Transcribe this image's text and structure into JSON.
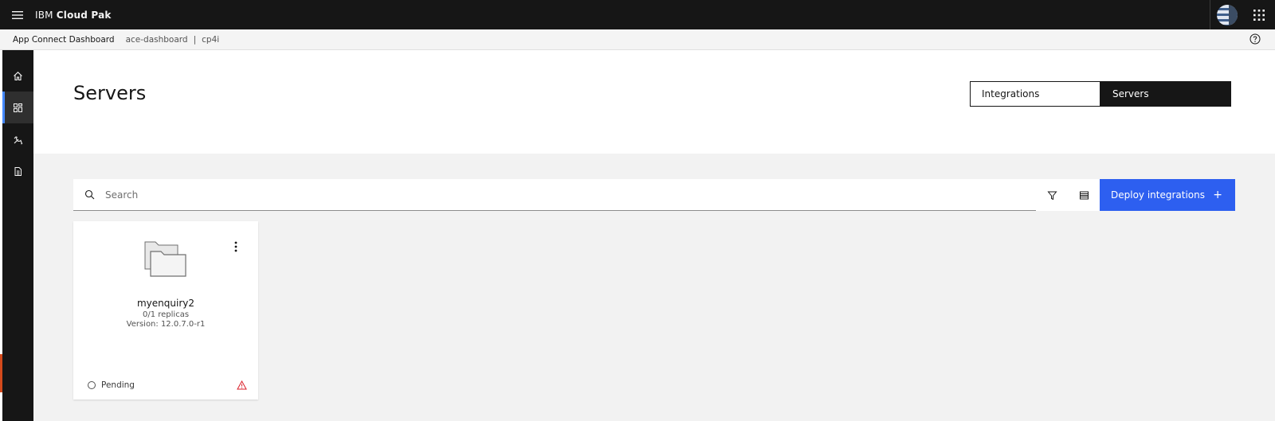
{
  "header": {
    "brand_prefix": "IBM",
    "brand_name": "Cloud Pak",
    "menu_icon": "hamburger-icon",
    "avatar_icon": "user-avatar",
    "switcher_icon": "app-switcher-icon"
  },
  "subbar": {
    "app_name": "App Connect Dashboard",
    "instance": "ace-dashboard",
    "separator": "|",
    "namespace": "cp4i",
    "help_icon": "help-icon"
  },
  "sidebar": {
    "items": [
      {
        "icon": "home-icon",
        "active": false
      },
      {
        "icon": "dashboard-icon",
        "active": true
      },
      {
        "icon": "tools-icon",
        "active": false
      },
      {
        "icon": "document-icon",
        "active": false
      }
    ]
  },
  "page": {
    "title": "Servers",
    "toggle": {
      "options": [
        "Integrations",
        "Servers"
      ],
      "selected": "Servers"
    }
  },
  "toolbar": {
    "search_placeholder": "Search",
    "filter_icon": "filter-icon",
    "view_icon": "list-view-icon",
    "deploy_label": "Deploy integrations",
    "deploy_icon": "+"
  },
  "servers": [
    {
      "name": "myenquiry2",
      "replicas": "0/1 replicas",
      "version": "Version: 12.0.7.0-r1",
      "status": "Pending",
      "warning": true
    }
  ],
  "colors": {
    "primary": "#2d5ff0",
    "header_bg": "#161616",
    "active_indicator": "#4589ff",
    "warning": "#da1e28"
  }
}
